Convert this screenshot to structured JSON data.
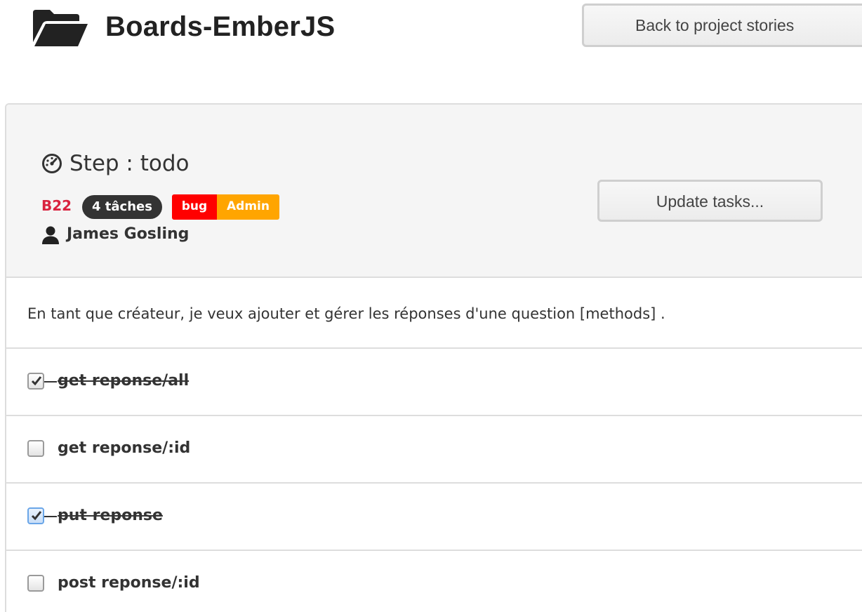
{
  "header": {
    "title": "Boards-EmberJS",
    "back_label": "Back to project stories"
  },
  "story": {
    "step_title": "Step : todo",
    "code": "B22",
    "tasks_count_label": "4 tâches",
    "tags": [
      {
        "label": "bug",
        "color": "#ff0000"
      },
      {
        "label": "Admin",
        "color": "#ffa500"
      }
    ],
    "owner": "James Gosling",
    "update_label": "Update tasks...",
    "description": "En tant que créateur, je veux ajouter et gérer les réponses d'une question [methods] ."
  },
  "tasks": [
    {
      "label": "get reponse/all",
      "done": true
    },
    {
      "label": "get reponse/:id",
      "done": false
    },
    {
      "label": "put reponse",
      "done": true
    },
    {
      "label": "post reponse/:id",
      "done": false
    }
  ]
}
